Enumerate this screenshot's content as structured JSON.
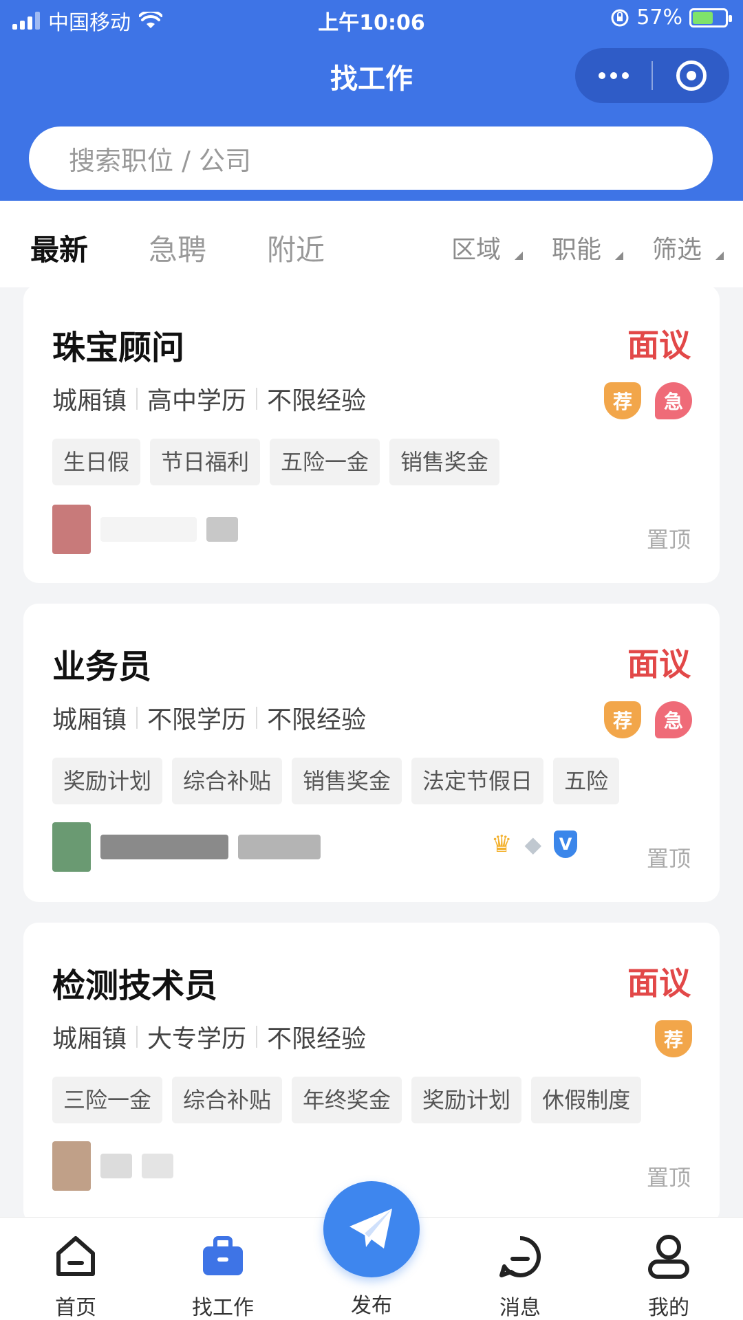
{
  "status_bar": {
    "carrier": "中国移动",
    "time": "上午10:06",
    "battery": "57%"
  },
  "header": {
    "title": "找工作",
    "search_placeholder": "搜索职位 / 公司"
  },
  "filters": {
    "tabs": [
      "最新",
      "急聘",
      "附近"
    ],
    "active_tab": "最新",
    "dropdowns": [
      "区域",
      "职能",
      "筛选"
    ]
  },
  "jobs": [
    {
      "title": "珠宝顾问",
      "salary": "面议",
      "location": "城厢镇",
      "education": "高中学历",
      "experience": "不限经验",
      "badges": [
        "荐",
        "急"
      ],
      "tags": [
        "生日假",
        "节日福利",
        "五险一金",
        "销售奖金"
      ],
      "pin_label": "置顶"
    },
    {
      "title": "业务员",
      "salary": "面议",
      "location": "城厢镇",
      "education": "不限学历",
      "experience": "不限经验",
      "badges": [
        "荐",
        "急"
      ],
      "tags": [
        "奖励计划",
        "综合补贴",
        "销售奖金",
        "法定节假日",
        "五险"
      ],
      "pin_label": "置顶",
      "company_icons": [
        "crown-icon",
        "diamond-icon",
        "V"
      ]
    },
    {
      "title": "检测技术员",
      "salary": "面议",
      "location": "城厢镇",
      "education": "大专学历",
      "experience": "不限经验",
      "badges": [
        "荐"
      ],
      "tags": [
        "三险一金",
        "综合补贴",
        "年终奖金",
        "奖励计划",
        "休假制度"
      ],
      "pin_label": "置顶"
    }
  ],
  "tabbar": {
    "items": [
      "首页",
      "找工作",
      "发布",
      "消息",
      "我的"
    ],
    "active": "找工作"
  },
  "colors": {
    "brand_blue": "#3e74e6",
    "salary_red": "#e24848",
    "recommend_orange": "#f2a64a",
    "urgent_pink": "#ef6b78"
  }
}
